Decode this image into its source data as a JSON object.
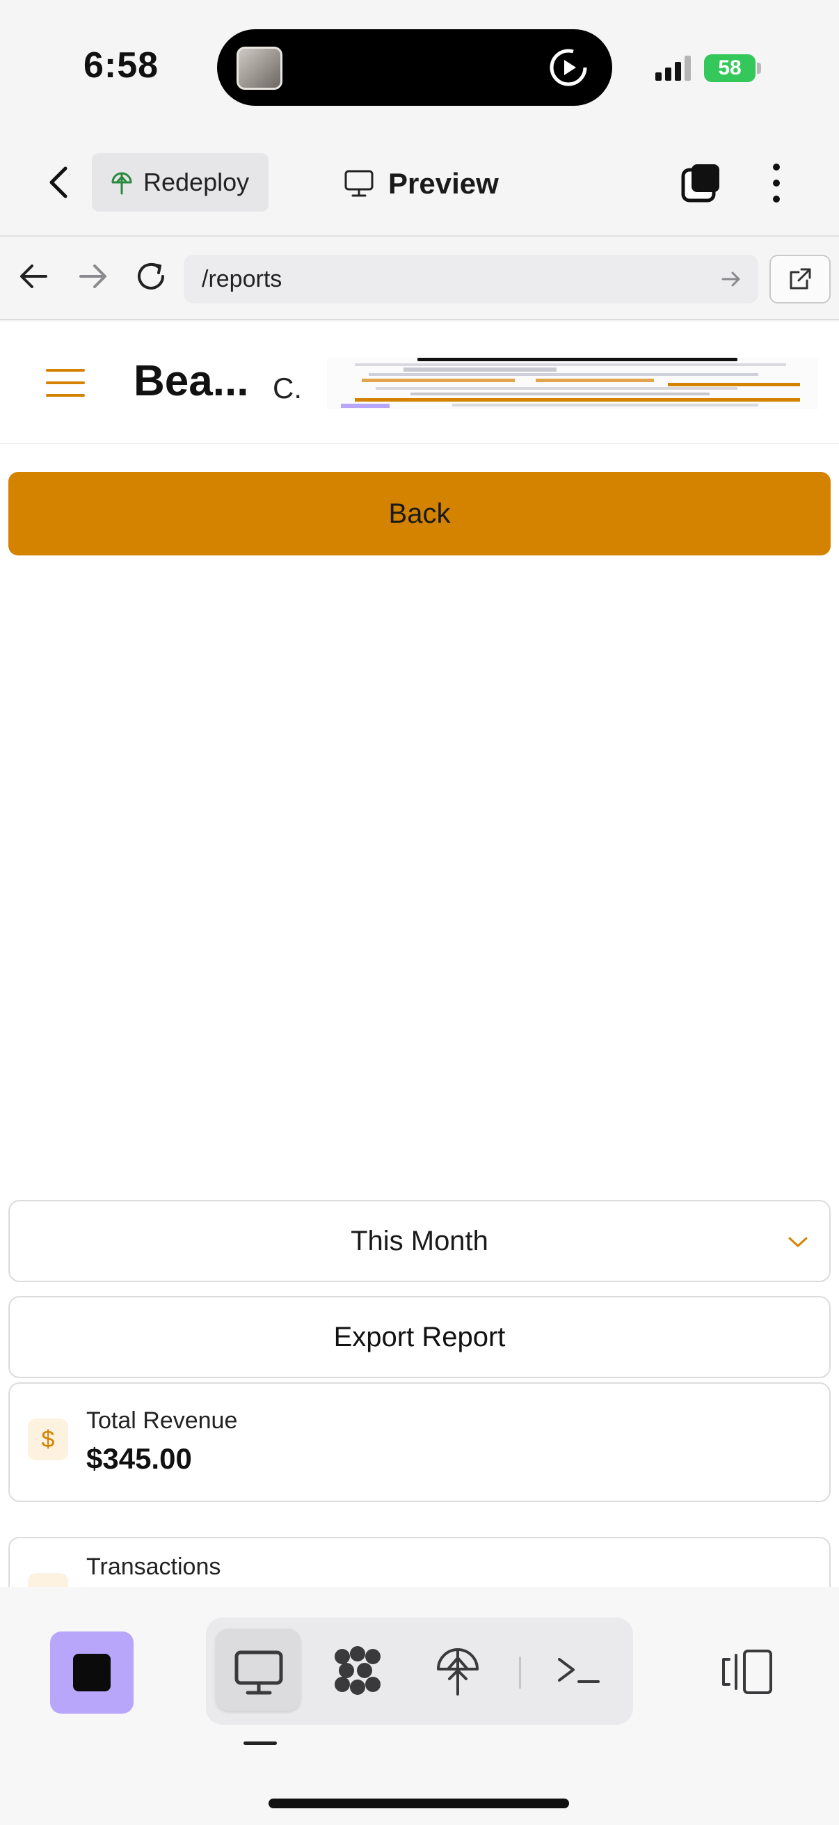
{
  "status_bar": {
    "time": "6:58",
    "battery": "58"
  },
  "header": {
    "redeploy_label": "Redeploy",
    "preview_label": "Preview"
  },
  "browser": {
    "url": "/reports"
  },
  "site": {
    "brand": "Bea...",
    "brand_sub": "C."
  },
  "content": {
    "back_label": "Back",
    "period_select": {
      "value": "This Month"
    },
    "export_label": "Export Report",
    "revenue": {
      "icon": "$",
      "label": "Total Revenue",
      "value": "$345.00"
    },
    "transactions": {
      "label": "Transactions"
    }
  },
  "colors": {
    "accent": "#d48300",
    "stop_button": "#b8a6fb",
    "battery": "#34c759"
  },
  "icons": {
    "toolbar": [
      "stop-icon",
      "monitor-icon",
      "nodes-icon",
      "deploy-icon",
      "terminal-icon",
      "device-switch-icon"
    ]
  }
}
